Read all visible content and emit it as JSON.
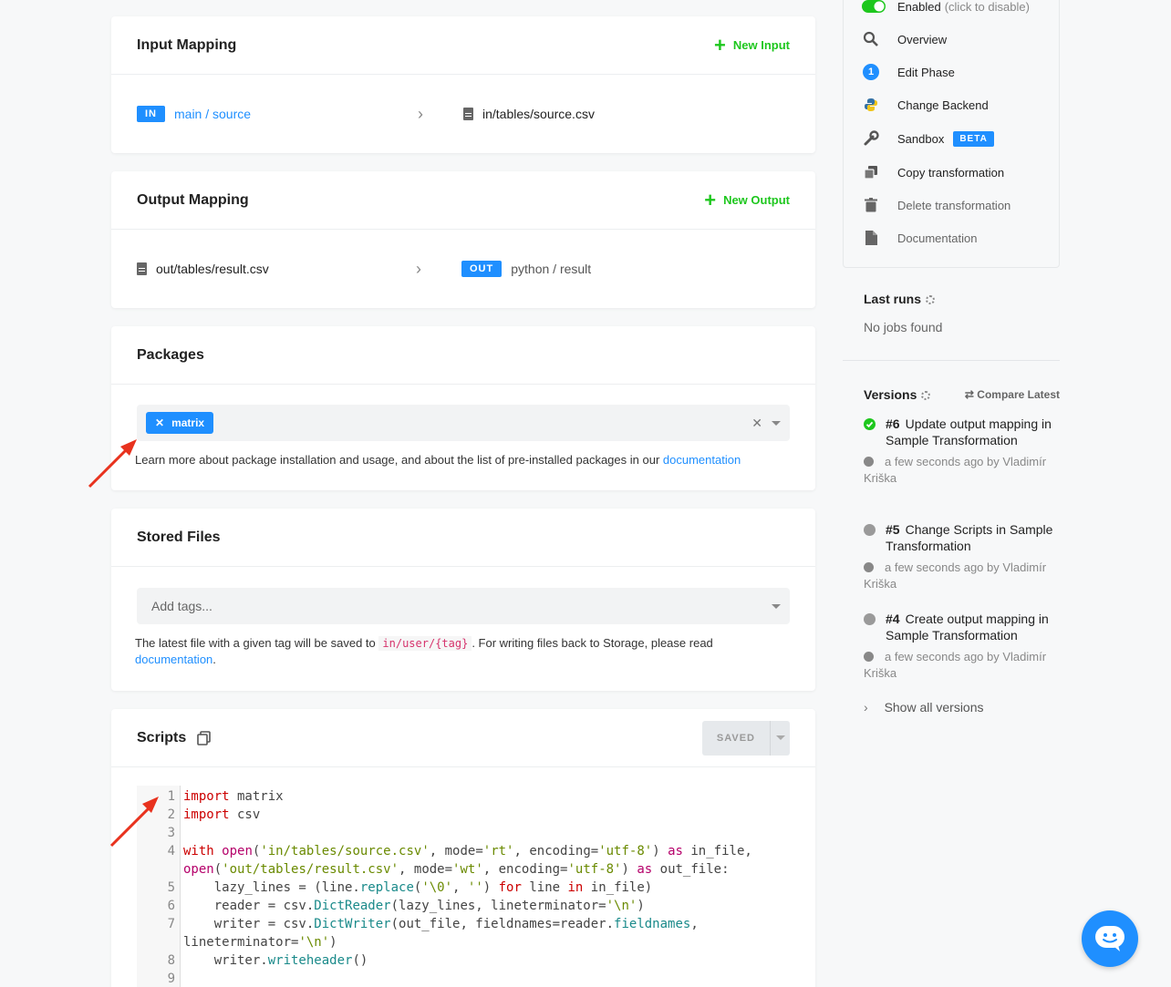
{
  "input_mapping": {
    "title": "Input Mapping",
    "action": "New Input",
    "badge": "IN",
    "source": "main / source",
    "destination": "in/tables/source.csv"
  },
  "output_mapping": {
    "title": "Output Mapping",
    "action": "New Output",
    "source": "out/tables/result.csv",
    "badge": "OUT",
    "destination": "python / result"
  },
  "packages": {
    "title": "Packages",
    "tag": "matrix",
    "help_text": "Learn more about package installation and usage, and about the list of pre-installed packages in our",
    "help_link": "documentation"
  },
  "stored_files": {
    "title": "Stored Files",
    "placeholder": "Add tags...",
    "help_before": "The latest file with a given tag will be saved to",
    "help_code": "in/user/{tag}",
    "help_after": ". For writing files back to Storage, please read",
    "help_link": "documentation",
    "help_end": "."
  },
  "scripts": {
    "title": "Scripts",
    "saved_label": "SAVED",
    "line_numbers": [
      "1",
      "2",
      "3",
      "4",
      "5",
      "6",
      "7",
      "8",
      "9"
    ]
  },
  "sidebar": {
    "enabled_label": "Enabled",
    "enabled_hint": "(click to disable)",
    "items": [
      {
        "label": "Overview",
        "icon": "search-icon"
      },
      {
        "label": "Edit Phase",
        "icon": "phase-number-icon",
        "badge": "1"
      },
      {
        "label": "Change Backend",
        "icon": "python-icon"
      },
      {
        "label": "Sandbox",
        "icon": "wrench-icon",
        "tag": "BETA"
      },
      {
        "label": "Copy transformation",
        "icon": "copy-icon"
      },
      {
        "label": "Delete transformation",
        "icon": "trash-icon"
      },
      {
        "label": "Documentation",
        "icon": "document-icon"
      }
    ],
    "last_runs_title": "Last runs",
    "no_jobs": "No jobs found",
    "versions_title": "Versions",
    "compare_latest": "Compare Latest",
    "versions": [
      {
        "number": "#6",
        "title": "Update output mapping in Sample Transformation",
        "meta": "a few seconds ago by Vladimír Kriška",
        "status_color": "#1ec71e"
      },
      {
        "number": "#5",
        "title": "Change Scripts in Sample Transformation",
        "meta": "a few seconds ago by Vladimír Kriška",
        "status_color": "#9a9a9a"
      },
      {
        "number": "#4",
        "title": "Create output mapping in Sample Transformation",
        "meta": "a few seconds ago by Vladimír Kriška",
        "status_color": "#9a9a9a"
      }
    ],
    "show_all": "Show all versions"
  },
  "colors": {
    "accent": "#1f8fff",
    "success": "#1ec71e",
    "annotation_arrow": "#e8321e"
  }
}
